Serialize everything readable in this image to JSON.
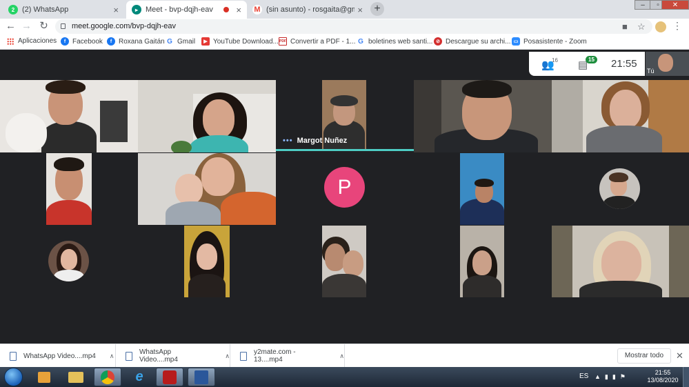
{
  "browser": {
    "tabs": [
      {
        "label": "(2) WhatsApp",
        "icon": "whatsapp-icon",
        "color": "#25d366",
        "active": false
      },
      {
        "label": "Meet - bvp-dqjh-eav",
        "icon": "meet-icon",
        "color": "#00897b",
        "active": true,
        "recording": true
      },
      {
        "label": "(sin asunto) - rosgaita@gmail.com",
        "icon": "gmail-icon",
        "color": "#ea4335",
        "active": false
      }
    ],
    "url": "meet.google.com/bvp-dqjh-eav",
    "bookmarks": [
      {
        "label": "Aplicaciones",
        "icon": "apps-grid-icon"
      },
      {
        "label": "Facebook",
        "icon": "facebook-icon",
        "color": "#1877f2",
        "glyph": "f"
      },
      {
        "label": "Roxana Gaitán",
        "icon": "facebook-icon",
        "color": "#1877f2",
        "glyph": "f"
      },
      {
        "label": "Gmail",
        "icon": "google-icon",
        "color": "#4285f4",
        "glyph": "G"
      },
      {
        "label": "YouTube Download...",
        "icon": "youtube-download-icon",
        "color": "#e53935",
        "glyph": "▶"
      },
      {
        "label": "Convertir a PDF - 1...",
        "icon": "pdf-icon",
        "color": "#c62828",
        "glyph": "PDF"
      },
      {
        "label": "boletines web santi...",
        "icon": "google-icon",
        "color": "#4285f4",
        "glyph": "G"
      },
      {
        "label": "Descargue su archi...",
        "icon": "no-entry-icon",
        "color": "#d32f2f",
        "glyph": "⊘"
      },
      {
        "label": "Posasistente - Zoom",
        "icon": "zoom-icon",
        "color": "#2d8cff",
        "glyph": "▭"
      }
    ]
  },
  "meet": {
    "participants_count": "16",
    "chat_count": "15",
    "time": "21:55",
    "self_label": "Tú",
    "active_speaker": "Margot Nuñez",
    "avatar_letter": "P",
    "avatar_color": "#e8457b",
    "speaking_color": "#4ecdc4"
  },
  "downloads": {
    "items": [
      {
        "label": "WhatsApp Video....mp4"
      },
      {
        "label": "WhatsApp Video....mp4"
      },
      {
        "label": "y2mate.com - 13....mp4"
      }
    ],
    "show_all": "Mostrar todo"
  },
  "taskbar": {
    "language": "ES",
    "time": "21:55",
    "date": "13/08/2020"
  }
}
